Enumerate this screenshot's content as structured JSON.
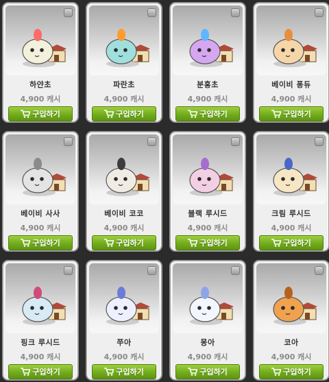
{
  "items": [
    {
      "name": "하얀초",
      "price": "4,900 캐시",
      "buy_label": "구입하기",
      "color": "#f3f0dc",
      "accent": "#ff6a6a"
    },
    {
      "name": "파란초",
      "price": "4,900 캐시",
      "buy_label": "구입하기",
      "color": "#9fe0df",
      "accent": "#ff9b2f"
    },
    {
      "name": "분홍초",
      "price": "4,900 캐시",
      "buy_label": "구입하기",
      "color": "#d6a6f0",
      "accent": "#5fb6ff"
    },
    {
      "name": "베이비 퐁듀",
      "price": "4,900 캐시",
      "buy_label": "구입하기",
      "color": "#f6d6a8",
      "accent": "#e88f3f"
    },
    {
      "name": "베이비 사사",
      "price": "4,900 캐시",
      "buy_label": "구입하기",
      "color": "#e4e4e4",
      "accent": "#8b8b8b"
    },
    {
      "name": "베이비 코코",
      "price": "4,900 캐시",
      "buy_label": "구입하기",
      "color": "#f1ece3",
      "accent": "#3c3c3c"
    },
    {
      "name": "블랙 루시드",
      "price": "4,900 캐시",
      "buy_label": "구입하기",
      "color": "#f3cfe3",
      "accent": "#a56dd0"
    },
    {
      "name": "크림 루시드",
      "price": "4,900 캐시",
      "buy_label": "구입하기",
      "color": "#f6e6c4",
      "accent": "#4a67c7"
    },
    {
      "name": "핑크 루시드",
      "price": "4,900 캐시",
      "buy_label": "구입하기",
      "color": "#d7eaf5",
      "accent": "#d04a7a"
    },
    {
      "name": "쭈아",
      "price": "4,900 캐시",
      "buy_label": "구입하기",
      "color": "#eef0ff",
      "accent": "#6d7bd8"
    },
    {
      "name": "몽아",
      "price": "4,900 캐시",
      "buy_label": "구입하기",
      "color": "#f4f6ff",
      "accent": "#8fa4e8"
    },
    {
      "name": "코아",
      "price": "4,900 캐시",
      "buy_label": "구입하기",
      "color": "#f0a24e",
      "accent": "#b8611f"
    }
  ],
  "colors": {
    "background": "#2b2b2b",
    "button_green": "#72ac1c",
    "price_gray": "#8a8a8a",
    "name_dark": "#333333"
  },
  "icons": {
    "select": "checkbox-icon",
    "cart": "cart-icon",
    "house": "pet-house-icon"
  }
}
